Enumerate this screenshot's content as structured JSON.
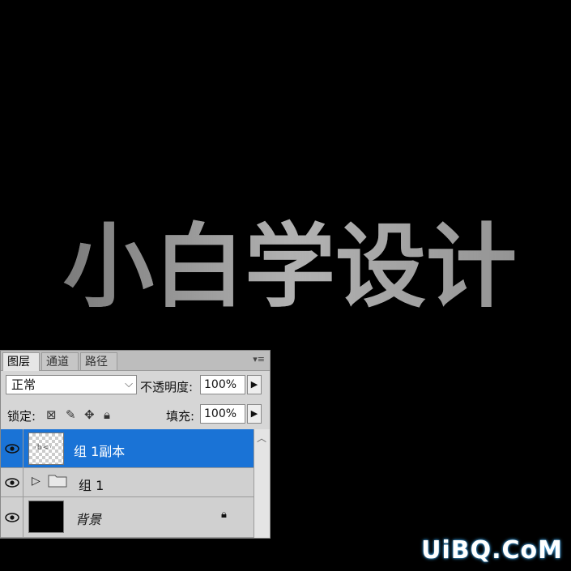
{
  "canvas": {
    "title_text": "小白学设计",
    "background": "#000000"
  },
  "watermark": "UiBQ.CoM",
  "layers_panel": {
    "tabs": [
      {
        "label": "图层",
        "active": true
      },
      {
        "label": "通道",
        "active": false
      },
      {
        "label": "路径",
        "active": false
      }
    ],
    "menu_icon": "panel-menu-icon",
    "blend_mode": "正常",
    "opacity_label": "不透明度:",
    "opacity_value": "100%",
    "lock_label": "锁定:",
    "lock_icons": [
      "lock-transparent-icon",
      "lock-paint-icon",
      "lock-move-icon",
      "lock-all-icon"
    ],
    "fill_label": "填充:",
    "fill_value": "100%",
    "layers": [
      {
        "name": "组 1副本",
        "selected": true,
        "type": "layer",
        "visible": true
      },
      {
        "name": "组 1",
        "selected": false,
        "type": "group",
        "visible": true
      },
      {
        "name": "背景",
        "selected": false,
        "type": "background",
        "visible": true,
        "locked": true
      }
    ],
    "selection_color": "#1a73d6"
  }
}
